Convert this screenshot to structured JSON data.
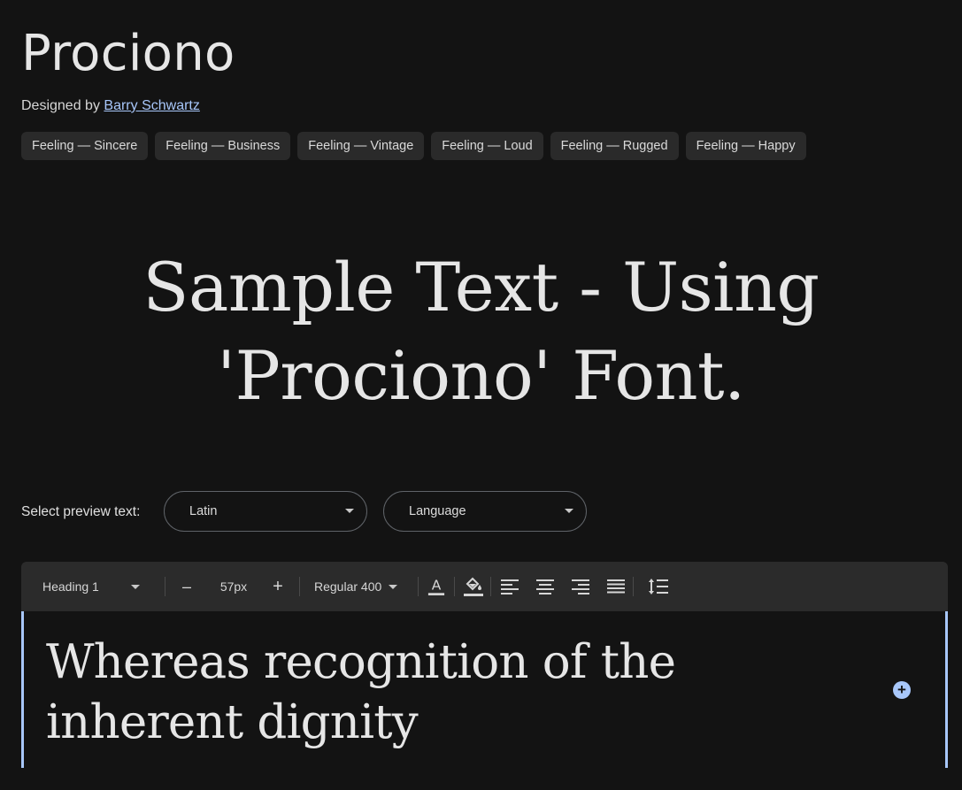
{
  "font": {
    "name": "Prociono",
    "designed_by_label": "Designed by",
    "designer": "Barry Schwartz"
  },
  "tags": [
    {
      "label": "Feeling — Sincere"
    },
    {
      "label": "Feeling — Business"
    },
    {
      "label": "Feeling — Vintage"
    },
    {
      "label": "Feeling — Loud"
    },
    {
      "label": "Feeling — Rugged"
    },
    {
      "label": "Feeling — Happy"
    }
  ],
  "hero": {
    "line1": "Sample Text - Using",
    "line2": "'Prociono' Font."
  },
  "preview": {
    "label": "Select preview text:",
    "script_value": "Latin",
    "language_placeholder": "Language"
  },
  "toolbar": {
    "style_value": "Heading 1",
    "decrease_symbol": "–",
    "size_value": "57px",
    "increase_symbol": "+",
    "weight_value": "Regular 400",
    "text_color_letter": "A"
  },
  "editor": {
    "text": "Whereas recognition of the inherent dignity",
    "add_symbol": "+"
  },
  "colors": {
    "background": "#131313",
    "accent": "#a8c7fa",
    "chip": "#2a2a2a",
    "toolbar": "#2b2b2b"
  }
}
